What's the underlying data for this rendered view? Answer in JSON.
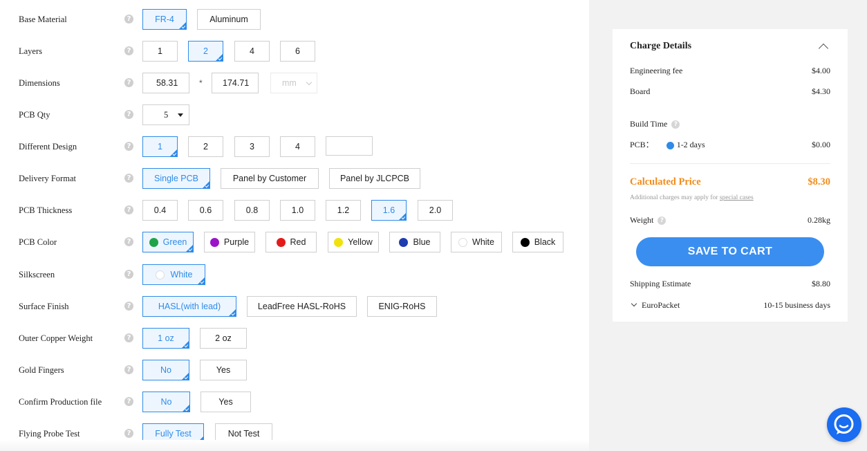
{
  "form": {
    "rows": [
      {
        "label": "Base Material",
        "options": [
          "FR-4",
          "Aluminum"
        ],
        "selected": 0
      },
      {
        "label": "Layers",
        "options": [
          "1",
          "2",
          "4",
          "6"
        ],
        "selected": 1
      },
      {
        "label": "Dimensions",
        "width": "58.31",
        "separator": "*",
        "height": "174.71",
        "unit": "mm"
      },
      {
        "label": "PCB Qty",
        "value": "5"
      },
      {
        "label": "Different Design",
        "options": [
          "1",
          "2",
          "3",
          "4"
        ],
        "selected": 0,
        "custom_value": ""
      },
      {
        "label": "Delivery Format",
        "options": [
          "Single PCB",
          "Panel by Customer",
          "Panel by JLCPCB"
        ],
        "selected": 0
      },
      {
        "label": "PCB Thickness",
        "options": [
          "0.4",
          "0.6",
          "0.8",
          "1.0",
          "1.2",
          "1.6",
          "2.0"
        ],
        "selected": 5
      },
      {
        "label": "PCB Color",
        "options": [
          "Green",
          "Purple",
          "Red",
          "Yellow",
          "Blue",
          "White",
          "Black"
        ],
        "selected": 0,
        "swatches": [
          "#1ea34a",
          "#9a14c8",
          "#e31b1b",
          "#f1e20b",
          "#1f3cb0",
          "#ffffff",
          "#000000"
        ]
      },
      {
        "label": "Silkscreen",
        "options": [
          "White"
        ],
        "selected": 0
      },
      {
        "label": "Surface Finish",
        "options": [
          "HASL(with lead)",
          "LeadFree HASL-RoHS",
          "ENIG-RoHS"
        ],
        "selected": 0
      },
      {
        "label": "Outer Copper Weight",
        "options": [
          "1 oz",
          "2 oz"
        ],
        "selected": 0
      },
      {
        "label": "Gold Fingers",
        "options": [
          "No",
          "Yes"
        ],
        "selected": 0
      },
      {
        "label": "Confirm Production file",
        "options": [
          "No",
          "Yes"
        ],
        "selected": 0
      },
      {
        "label": "Flying Probe Test",
        "options": [
          "Fully Test",
          "Not Test"
        ],
        "selected": 0
      }
    ]
  },
  "charge": {
    "title": "Charge Details",
    "engineering_fee_label": "Engineering fee",
    "engineering_fee": "$4.00",
    "board_label": "Board",
    "board": "$4.30",
    "build_time_label": "Build Time",
    "pcb_label": "PCB：",
    "pcb_time": "1-2 days",
    "pcb_price": "$0.00",
    "calculated_label": "Calculated Price",
    "calculated_price": "$8.30",
    "note_prefix": "Additional charges may apply for ",
    "note_link": "special cases",
    "weight_label": "Weight",
    "weight": "0.28kg",
    "save_button": "SAVE TO CART",
    "shipping_label": "Shipping Estimate",
    "shipping": "$8.80",
    "carrier": "EuroPacket",
    "carrier_time": "10-15 business days"
  },
  "colors": {
    "accent": "#2e8be8",
    "price": "#f08d1d",
    "button": "#3a8ef0",
    "chat": "#1a6cf0"
  }
}
